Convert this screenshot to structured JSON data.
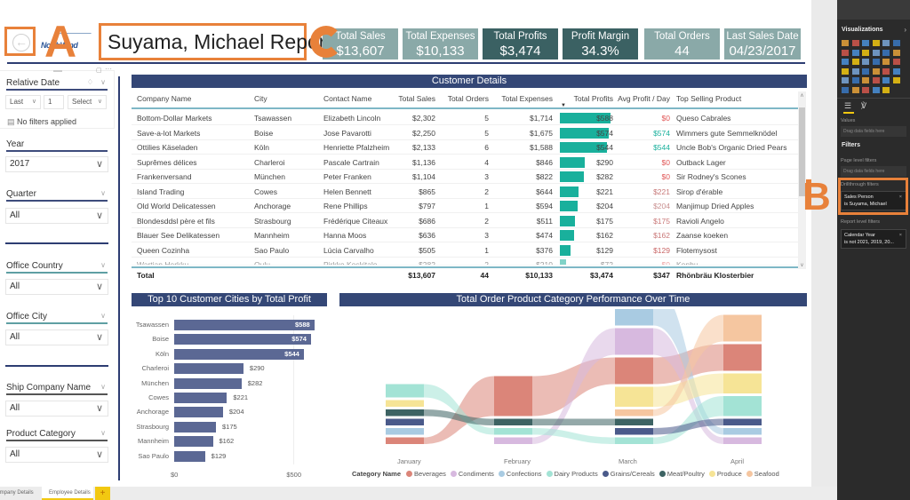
{
  "header": {
    "title": "Suyama, Michael Report",
    "logo_text": "NorthWind",
    "back_icon": "back-arrow-icon",
    "annotations": {
      "a": "A",
      "b": "B",
      "c": "C"
    }
  },
  "kpis": [
    {
      "label": "Total Sales",
      "value": "$13,607",
      "style": "light"
    },
    {
      "label": "Total Expenses",
      "value": "$10,133",
      "style": "light"
    },
    {
      "label": "Total Profits",
      "value": "$3,474",
      "style": "dark"
    },
    {
      "label": "Profit Margin",
      "value": "34.3%",
      "style": "dark"
    },
    {
      "label": "Total Orders",
      "value": "44",
      "style": "light"
    },
    {
      "label": "Last Sales Date",
      "value": "04/23/2017",
      "style": "light"
    }
  ],
  "slicers": {
    "relative_date": {
      "label": "Relative Date",
      "mode": "Last",
      "count": "1",
      "unit": "Select",
      "status": "No filters applied"
    },
    "year": {
      "label": "Year",
      "value": "2017"
    },
    "quarter": {
      "label": "Quarter",
      "value": "All"
    },
    "office_country": {
      "label": "Office Country",
      "value": "All"
    },
    "office_city": {
      "label": "Office City",
      "value": "All"
    },
    "ship_company": {
      "label": "Ship Company Name",
      "value": "All"
    },
    "product_category": {
      "label": "Product Category",
      "value": "All"
    }
  },
  "customer_table": {
    "title": "Customer Details",
    "columns": [
      "Company Name",
      "City",
      "Contact Name",
      "Total Sales",
      "Total Orders",
      "Total Expenses",
      "Total Profits",
      "Avg Profit / Day",
      "Top Selling Product"
    ],
    "sorted_column": "Total Profits",
    "rows": [
      [
        "Bottom-Dollar Markets",
        "Tsawassen",
        "Elizabeth Lincoln",
        "$2,302",
        "5",
        "$1,714",
        "$588",
        "$0",
        "Queso Cabrales"
      ],
      [
        "Save-a-lot Markets",
        "Boise",
        "Jose Pavarotti",
        "$2,250",
        "5",
        "$1,675",
        "$574",
        "$574",
        "Wimmers gute Semmelknödel"
      ],
      [
        "Ottilies Käseladen",
        "Köln",
        "Henriette Pfalzheim",
        "$2,133",
        "6",
        "$1,588",
        "$544",
        "$544",
        "Uncle Bob's Organic Dried Pears"
      ],
      [
        "Suprêmes délices",
        "Charleroi",
        "Pascale Cartrain",
        "$1,136",
        "4",
        "$846",
        "$290",
        "$0",
        "Outback Lager"
      ],
      [
        "Frankenversand",
        "München",
        "Peter Franken",
        "$1,104",
        "3",
        "$822",
        "$282",
        "$0",
        "Sir Rodney's Scones"
      ],
      [
        "Island Trading",
        "Cowes",
        "Helen Bennett",
        "$865",
        "2",
        "$644",
        "$221",
        "$221",
        "Sirop d'érable"
      ],
      [
        "Old World Delicatessen",
        "Anchorage",
        "Rene Phillips",
        "$797",
        "1",
        "$594",
        "$204",
        "$204",
        "Manjimup Dried Apples"
      ],
      [
        "Blondesddsl père et fils",
        "Strasbourg",
        "Frédérique Citeaux",
        "$686",
        "2",
        "$511",
        "$175",
        "$175",
        "Ravioli Angelo"
      ],
      [
        "Blauer See Delikatessen",
        "Mannheim",
        "Hanna Moos",
        "$636",
        "3",
        "$474",
        "$162",
        "$162",
        "Zaanse koeken"
      ],
      [
        "Queen Cozinha",
        "Sao Paulo",
        "Lúcia Carvalho",
        "$505",
        "1",
        "$376",
        "$129",
        "$129",
        "Flotemysost"
      ],
      [
        "Wartian Herkku",
        "Oulu",
        "Pirkko Koskitalo",
        "$282",
        "2",
        "$210",
        "$72",
        "$0",
        "Konbu"
      ]
    ],
    "profit_values": [
      588,
      574,
      544,
      290,
      282,
      221,
      204,
      175,
      162,
      129,
      72
    ],
    "avg_colors": [
      "#e05555",
      "#19b09c",
      "#19b09c",
      "#e05555",
      "#e05555",
      "#c77777",
      "#c99090",
      "#c97777",
      "#c97777",
      "#c96666",
      "#e05555"
    ],
    "total": [
      "Total",
      "",
      "",
      "$13,607",
      "44",
      "$10,133",
      "$3,474",
      "$347",
      "Rhönbräu Klosterbier"
    ]
  },
  "chart_data": [
    {
      "type": "bar",
      "title": "Top 10 Customer Cities by Total Profit",
      "categories": [
        "Tsawassen",
        "Boise",
        "Köln",
        "Charleroi",
        "München",
        "Cowes",
        "Anchorage",
        "Strasbourg",
        "Mannheim",
        "Sao Paulo"
      ],
      "values": [
        588,
        574,
        544,
        290,
        282,
        221,
        204,
        175,
        162,
        129
      ],
      "value_labels": [
        "$588",
        "$574",
        "$544",
        "$290",
        "$282",
        "$221",
        "$204",
        "$175",
        "$162",
        "$129"
      ],
      "xlim": [
        0,
        620
      ],
      "x_ticks": [
        "$0",
        "$500"
      ],
      "orientation": "horizontal",
      "color": "#5b6894"
    },
    {
      "type": "area",
      "subtype": "ribbon",
      "title": "Total Order Product Category Performance Over Time",
      "categories": [
        "January",
        "February",
        "March",
        "April"
      ],
      "legend_title": "Category Name",
      "legend_position": "bottom",
      "series": [
        {
          "name": "Beverages",
          "color": "#db8579",
          "values": [
            1,
            6,
            4,
            4
          ]
        },
        {
          "name": "Condiments",
          "color": "#d7b9df",
          "values": [
            0,
            1,
            4,
            1
          ]
        },
        {
          "name": "Confections",
          "color": "#a9cbe2",
          "values": [
            1,
            0,
            6,
            1
          ]
        },
        {
          "name": "Dairy Products",
          "color": "#a3e3d5",
          "values": [
            2,
            1,
            1,
            3
          ]
        },
        {
          "name": "Grains/Cereals",
          "color": "#4a5a8a",
          "values": [
            1,
            0,
            1,
            1
          ]
        },
        {
          "name": "Meat/Poultry",
          "color": "#3d6363",
          "values": [
            1,
            1,
            1,
            0
          ]
        },
        {
          "name": "Produce",
          "color": "#f6e496",
          "values": [
            1,
            0,
            3,
            3
          ]
        },
        {
          "name": "Seafood",
          "color": "#f5c6a0",
          "values": [
            0,
            0,
            1,
            4
          ]
        }
      ]
    }
  ],
  "right_pane": {
    "visualizations_title": "Visualizations",
    "values_label": "Values",
    "drag_hint": "Drag data fields here",
    "filters_title": "Filters",
    "page_level": "Page level filters",
    "drillthrough": "Drillthrough filters",
    "drill_card": {
      "field": "Sales Person",
      "value": "is Suyama, Michael"
    },
    "report_level": "Report level filters",
    "report_card": {
      "field": "Calendar Year",
      "value": "is not 2021, 2019, 20..."
    }
  },
  "tabs": [
    {
      "label": "Company Details",
      "active": false
    },
    {
      "label": "Employee Details",
      "active": true
    }
  ],
  "add_tab_label": "+"
}
